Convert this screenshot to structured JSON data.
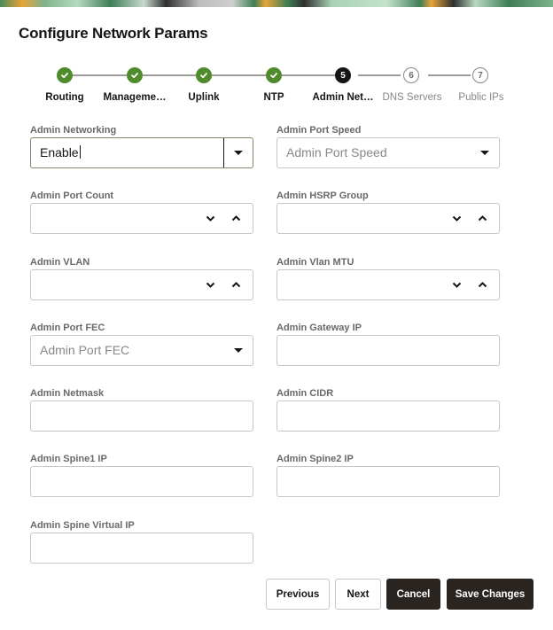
{
  "page": {
    "title": "Configure Network Params"
  },
  "train": {
    "steps": [
      {
        "label": "Routing",
        "state": "done",
        "number": "1"
      },
      {
        "label": "Manageme…",
        "state": "done",
        "number": "2"
      },
      {
        "label": "Uplink",
        "state": "done",
        "number": "3"
      },
      {
        "label": "NTP",
        "state": "done",
        "number": "4"
      },
      {
        "label": "Admin Net…",
        "state": "current",
        "number": "5"
      },
      {
        "label": "DNS Servers",
        "state": "future",
        "number": "6"
      },
      {
        "label": "Public IPs",
        "state": "future",
        "number": "7"
      }
    ],
    "done_color": "#4f8a2b",
    "current_color": "#161513"
  },
  "form": {
    "admin_networking": {
      "label": "Admin Networking",
      "value": "Enable"
    },
    "admin_port_speed": {
      "label": "Admin Port Speed",
      "placeholder": "Admin Port Speed",
      "value": ""
    },
    "admin_port_count": {
      "label": "Admin Port Count",
      "value": ""
    },
    "admin_hsrp_group": {
      "label": "Admin HSRP Group",
      "value": ""
    },
    "admin_vlan": {
      "label": "Admin VLAN",
      "value": ""
    },
    "admin_vlan_mtu": {
      "label": "Admin Vlan MTU",
      "value": ""
    },
    "admin_port_fec": {
      "label": "Admin Port FEC",
      "placeholder": "Admin Port FEC",
      "value": ""
    },
    "admin_gateway_ip": {
      "label": "Admin Gateway IP",
      "value": ""
    },
    "admin_netmask": {
      "label": "Admin Netmask",
      "value": ""
    },
    "admin_cidr": {
      "label": "Admin CIDR",
      "value": ""
    },
    "admin_spine1_ip": {
      "label": "Admin Spine1 IP",
      "value": ""
    },
    "admin_spine2_ip": {
      "label": "Admin Spine2 IP",
      "value": ""
    },
    "admin_spine_virtual_ip": {
      "label": "Admin Spine Virtual IP",
      "value": ""
    }
  },
  "footer": {
    "previous_label": "Previous",
    "next_label": "Next",
    "cancel_label": "Cancel",
    "save_label": "Save Changes"
  }
}
